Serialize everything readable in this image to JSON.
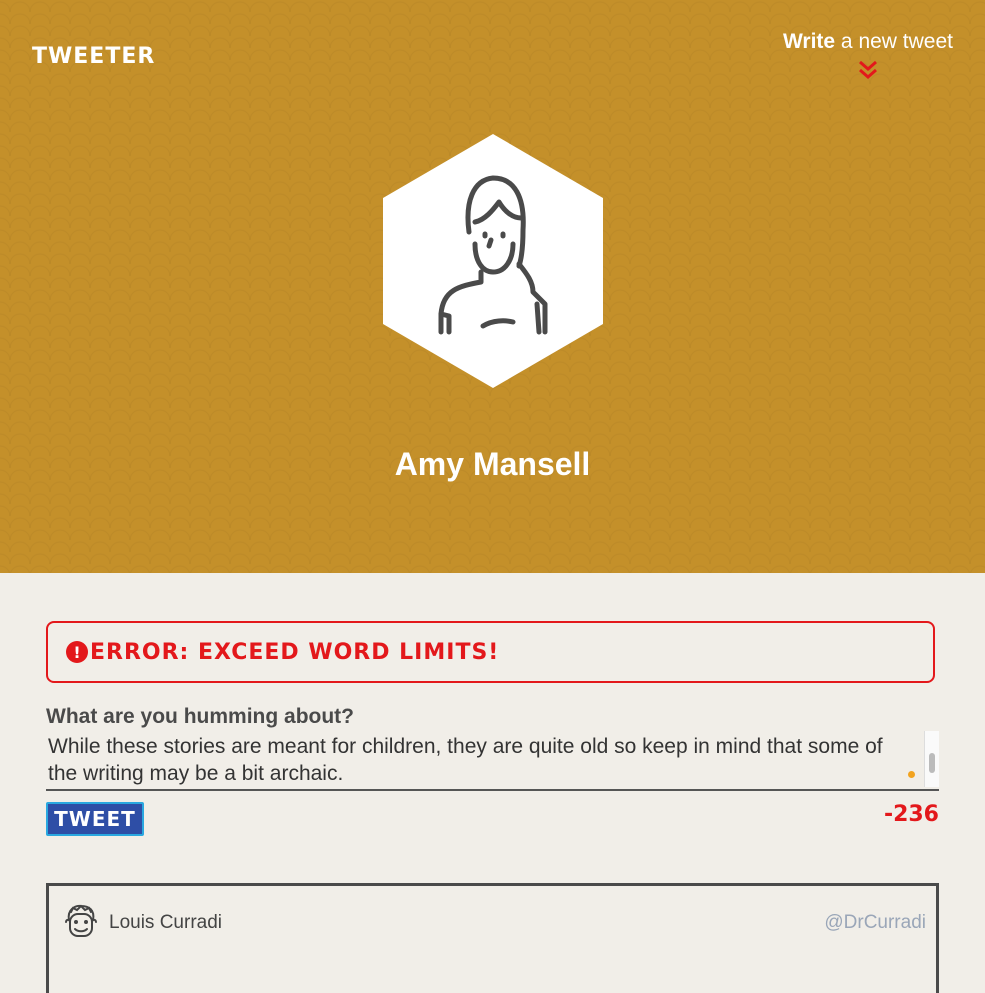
{
  "app": {
    "brand": "TWEETER"
  },
  "header": {
    "compose_bold": "Write",
    "compose_rest": " a new tweet",
    "compose_icon": "double-chevron-down-icon",
    "accent_color": "#e3181b",
    "background_color": "#c4902a"
  },
  "profile": {
    "name": "Amy Mansell",
    "avatar_icon": "woman-avatar-icon"
  },
  "compose": {
    "error_message": "Error: Exceed Word Limits!",
    "prompt": "What are you humming about?",
    "text": "While these stories are meant for children, they are quite old so keep in mind that some of the writing may be a bit archaic.",
    "submit_label": "Tweet",
    "char_counter": "-236"
  },
  "feed": {
    "tweets": [
      {
        "author": "Louis Curradi",
        "handle": "@DrCurradi",
        "avatar_icon": "man-avatar-icon"
      }
    ]
  }
}
